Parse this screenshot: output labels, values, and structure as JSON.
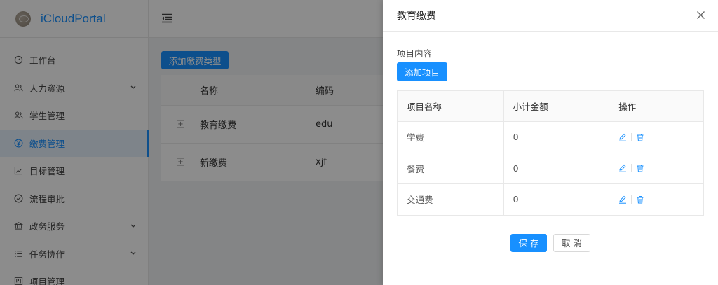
{
  "app": {
    "name": "iCloudPortal"
  },
  "sidebar": {
    "items": [
      {
        "label": "工作台",
        "icon": "dashboard-icon"
      },
      {
        "label": "人力资源",
        "icon": "users-icon",
        "has_children": true
      },
      {
        "label": "学生管理",
        "icon": "users-icon"
      },
      {
        "label": "缴费管理",
        "icon": "yen-circle-icon",
        "active": true
      },
      {
        "label": "目标管理",
        "icon": "line-chart-icon"
      },
      {
        "label": "流程审批",
        "icon": "check-circle-icon"
      },
      {
        "label": "政务服务",
        "icon": "bank-icon",
        "has_children": true
      },
      {
        "label": "任务协作",
        "icon": "list-icon",
        "has_children": true
      },
      {
        "label": "项目管理",
        "icon": "project-icon"
      }
    ]
  },
  "content": {
    "add_type_label": "添加缴费类型",
    "table": {
      "columns": [
        "名称",
        "编码"
      ],
      "rows": [
        {
          "name": "教育缴费",
          "code": "edu"
        },
        {
          "name": "新缴费",
          "code": "xjf"
        }
      ]
    }
  },
  "drawer": {
    "title": "教育缴费",
    "section_label": "项目内容",
    "add_item_label": "添加项目",
    "table": {
      "columns": [
        "项目名称",
        "小计金额",
        "操作"
      ],
      "rows": [
        {
          "name": "学费",
          "amount": "0"
        },
        {
          "name": "餐费",
          "amount": "0"
        },
        {
          "name": "交通费",
          "amount": "0"
        }
      ]
    },
    "save_label": "保 存",
    "cancel_label": "取 消"
  },
  "colors": {
    "primary": "#1890ff",
    "mask": "rgba(0,0,0,0.45)"
  }
}
